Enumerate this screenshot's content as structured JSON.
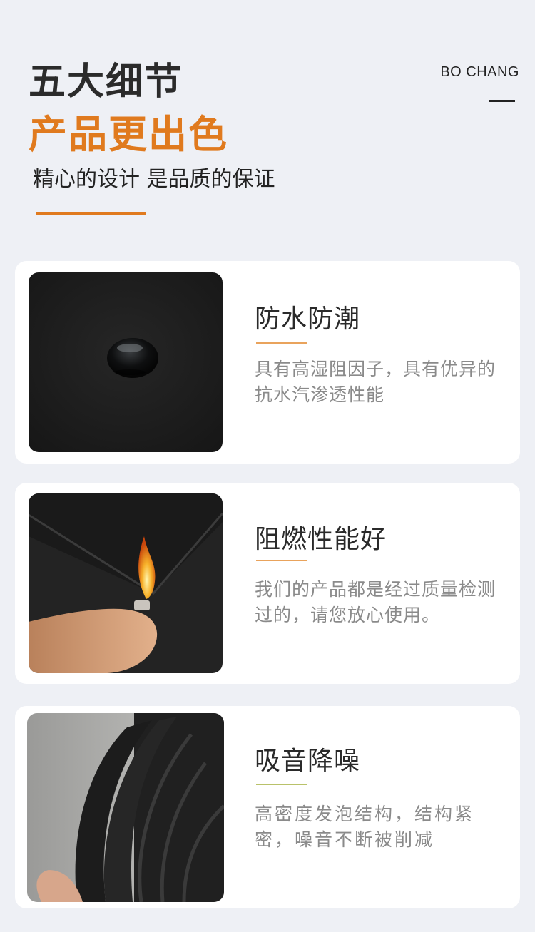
{
  "header": {
    "title_line1": "五大细节",
    "title_line2": "产品更出色",
    "subtitle": "精心的设计 是品质的保证",
    "brand": "BO CHANG",
    "accent_color": "#e07a1e"
  },
  "features": [
    {
      "title": "防水防潮",
      "description": "具有高湿阻因子，具有优异的抗水汽渗透性能",
      "image": "black-foam-water-droplet-photo"
    },
    {
      "title": "阻燃性能好",
      "description": "我们的产品都是经过质量检测过的，请您放心使用。",
      "image": "lighter-flame-on-foam-photo"
    },
    {
      "title": "吸音降噪",
      "description": "高密度发泡结构，结构紧密，噪音不断被削减",
      "image": "rolled-foam-tube-photo"
    }
  ]
}
